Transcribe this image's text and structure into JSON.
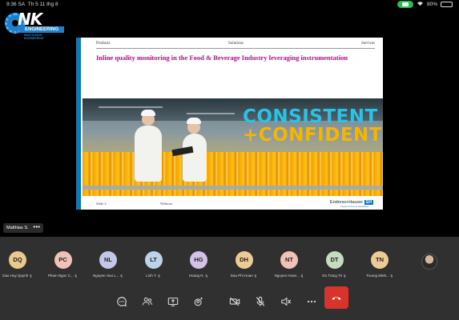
{
  "status": {
    "time": "9:36 SA",
    "date": "Th 5 11 thg 8",
    "battery": "80%",
    "battery_level": 0.8
  },
  "logo": {
    "brand": "NK",
    "line": "ENGINEERING",
    "sub": "NHAT KHANG ENGINEERING"
  },
  "slide": {
    "nav": [
      "Products",
      "Solutions",
      "Services"
    ],
    "title": "Inline quality monitoring in the Food & Beverage Industry leveraging instrumentation",
    "headline1": "CONSISTENT",
    "headline2": "+CONFIDENT",
    "footer_slide": "Slide 2",
    "footer_event": "Webinar",
    "brand": "Endress+Hauser",
    "brand_mark": "EH",
    "tagline": "People for Process Automation"
  },
  "speaker": {
    "name": "Matthias S.",
    "more": "•••"
  },
  "participants": [
    {
      "initials": "DQ",
      "name": "Dao Huy Quynh",
      "color": "#e9c98c"
    },
    {
      "initials": "PC",
      "name": "Pham Ngoc C...",
      "color": "#f2c2b8"
    },
    {
      "initials": "NL",
      "name": "Nguyen Huu L...",
      "color": "#c3c7e8"
    },
    {
      "initials": "LT",
      "name": "Linh T.",
      "color": "#bcd3e8"
    },
    {
      "initials": "HG",
      "name": "Hoang N.",
      "color": "#d2c3e6"
    },
    {
      "initials": "DH",
      "name": "Dau Phi Hoan",
      "color": "#eccb95"
    },
    {
      "initials": "NT",
      "name": "Nguyen Hoan...",
      "color": "#f2c2b8"
    },
    {
      "initials": "DT",
      "name": "Do Trang Tri",
      "color": "#c5dcc0"
    },
    {
      "initials": "TN",
      "name": "Truong Minh...",
      "color": "#eccb95"
    }
  ],
  "colors": {
    "accent_blue": "#0a7ac0",
    "title_magenta": "#b0158a",
    "end_call": "#d9342b",
    "strip_bg": "#303030"
  }
}
